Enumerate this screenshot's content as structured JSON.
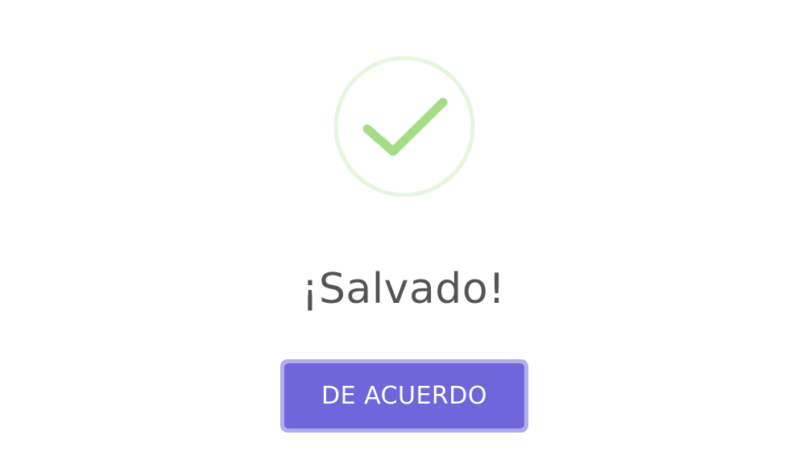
{
  "dialog": {
    "icon": "success-checkmark-icon",
    "title": "¡Salvado!",
    "confirm_label": "DE ACUERDO"
  },
  "colors": {
    "check_stroke": "#a5dc86",
    "check_ring": "#e6f5dd",
    "title_text": "#545454",
    "button_bg": "#7066dc",
    "button_focus_ring": "#b3acec",
    "button_text": "#ffffff"
  }
}
